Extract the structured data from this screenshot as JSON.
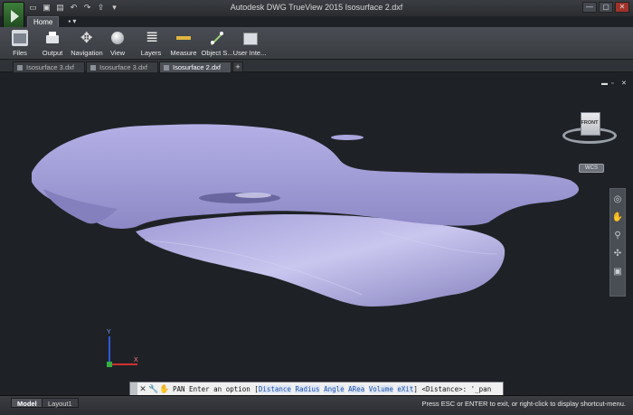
{
  "window": {
    "title": "Autodesk DWG TrueView 2015     Isosurface 2.dxf"
  },
  "ribbon": {
    "tabs": [
      "Home",
      "▪ ▾"
    ],
    "buttons": [
      {
        "label": "Files",
        "icon": "folder-icon"
      },
      {
        "label": "Output",
        "icon": "printer-icon"
      },
      {
        "label": "Navigation",
        "icon": "navigation-icon"
      },
      {
        "label": "View",
        "icon": "view-icon"
      },
      {
        "label": "Layers",
        "icon": "layers-icon"
      },
      {
        "label": "Measure",
        "icon": "measure-icon"
      },
      {
        "label": "Object S...",
        "icon": "object-snap-icon"
      },
      {
        "label": "User Inte...",
        "icon": "user-interface-icon"
      }
    ]
  },
  "document_tabs": [
    {
      "label": "Isosurface 3.dxf",
      "active": false
    },
    {
      "label": "Isosurface 3.dxf",
      "active": false
    },
    {
      "label": "Isosurface 2.dxf",
      "active": true
    }
  ],
  "new_tab_label": "+",
  "viewcube": {
    "face_label": "FRONT",
    "wcs_label": "WCS"
  },
  "ucs": {
    "y_label": "Y",
    "x_label": "X"
  },
  "command_line": {
    "prefix": "PAN Enter an option [",
    "options": [
      "Distance",
      "Radius",
      "Angle",
      "ARea",
      "Volume",
      "eXit"
    ],
    "suffix": "] <Distance>: '_pan"
  },
  "layout_tabs": [
    {
      "label": "Model",
      "active": true
    },
    {
      "label": "Layout1",
      "active": false
    }
  ],
  "status_message": "Press ESC or ENTER to exit, or right-click to display shortcut-menu.",
  "colors": {
    "surface": "#9a96cf",
    "background": "#1e2226"
  }
}
